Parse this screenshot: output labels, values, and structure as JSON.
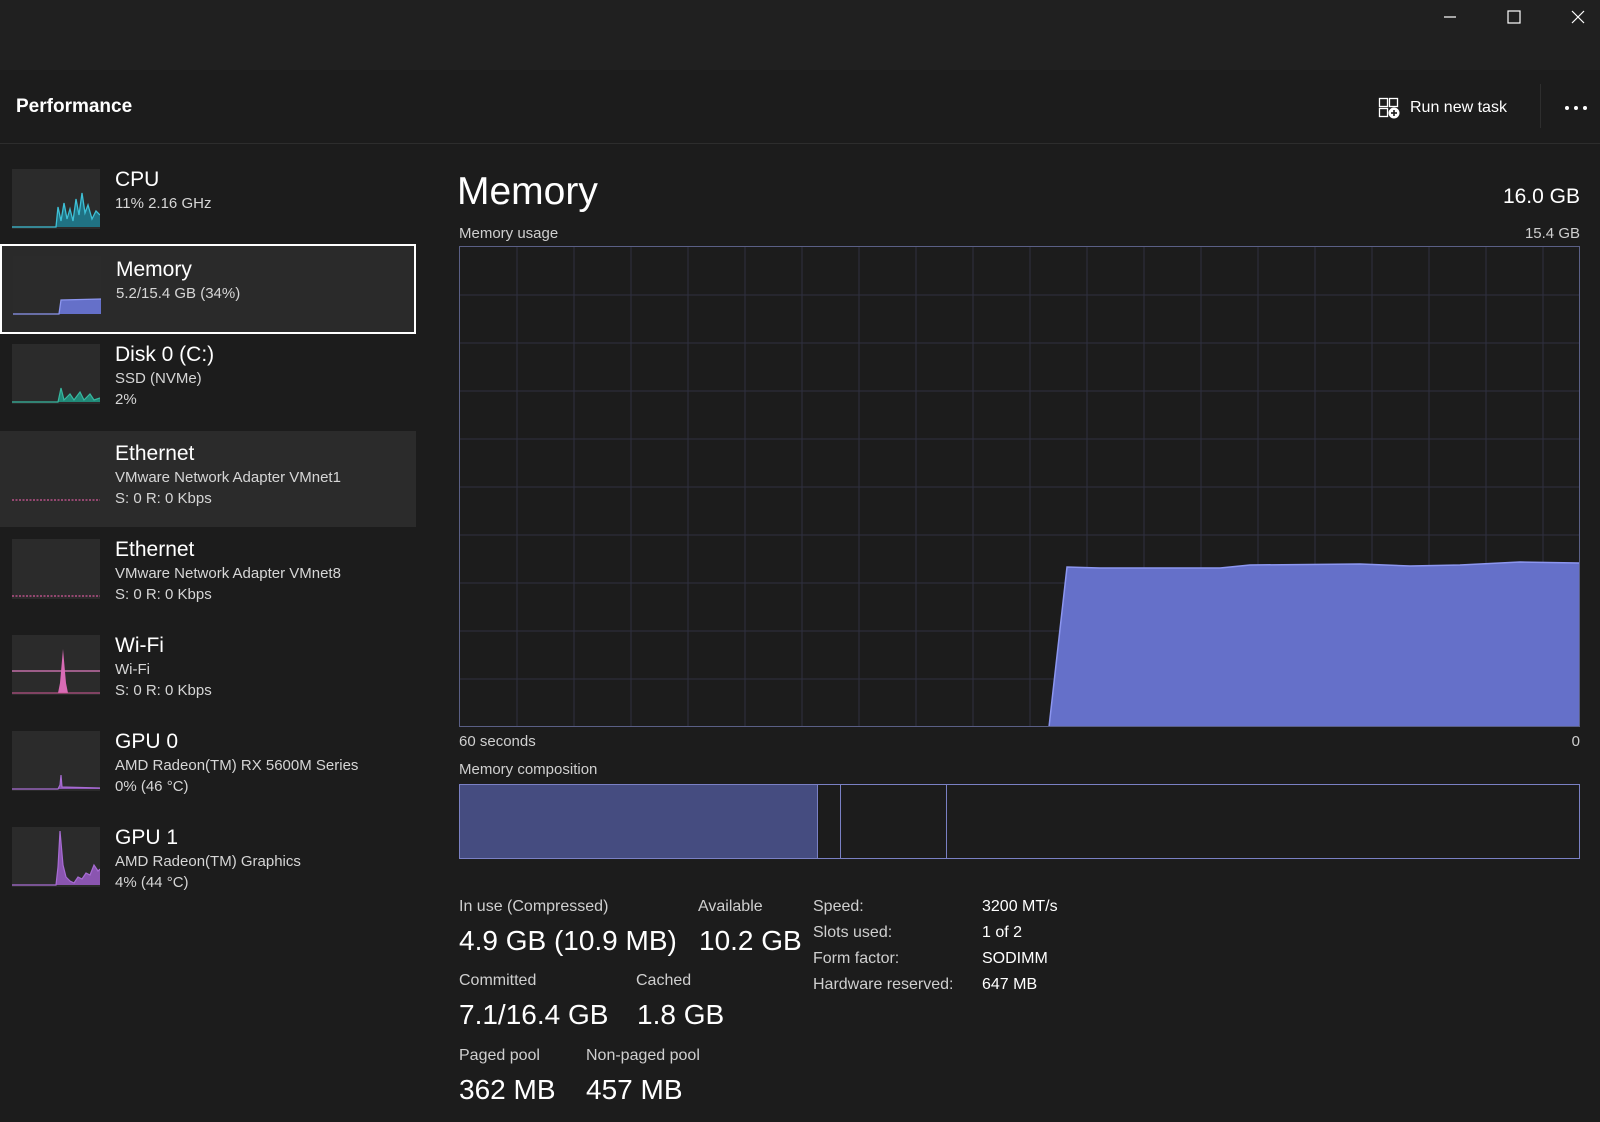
{
  "window": {
    "controls": {
      "minimize_icon": "minimize-icon",
      "maximize_icon": "maximize-icon",
      "close_icon": "close-icon"
    }
  },
  "header": {
    "title": "Performance",
    "run_new_task": "Run new task",
    "run_new_task_icon": "run-task-icon",
    "more_icon": "more-icon"
  },
  "sidebar": {
    "items": [
      {
        "title": "CPU",
        "line1": "11%  2.16 GHz",
        "line2": "",
        "color": "#3ec0d6"
      },
      {
        "title": "Memory",
        "line1": "5.2/15.4 GB (34%)",
        "line2": "",
        "color": "#7b87e8",
        "selected": true
      },
      {
        "title": "Disk 0 (C:)",
        "line1": "SSD (NVMe)",
        "line2": "2%",
        "color": "#37b8a0"
      },
      {
        "title": "Ethernet",
        "line1": "VMware Network Adapter VMnet1",
        "line2": "S: 0  R: 0 Kbps",
        "color": "#d4589a"
      },
      {
        "title": "Ethernet",
        "line1": "VMware Network Adapter VMnet8",
        "line2": "S: 0  R: 0 Kbps",
        "color": "#d4589a"
      },
      {
        "title": "Wi-Fi",
        "line1": "Wi-Fi",
        "line2": "S: 0  R: 0 Kbps",
        "color": "#e07bc0"
      },
      {
        "title": "GPU 0",
        "line1": "AMD Radeon(TM) RX 5600M Series",
        "line2": "0%  (46 °C)",
        "color": "#a86cd4"
      },
      {
        "title": "GPU 1",
        "line1": "AMD Radeon(TM) Graphics",
        "line2": "4%  (44 °C)",
        "color": "#a86cd4"
      }
    ]
  },
  "main": {
    "title": "Memory",
    "total": "16.0 GB",
    "usage_label": "Memory usage",
    "usage_max": "15.4 GB",
    "time_left": "60 seconds",
    "time_right": "0",
    "composition_label": "Memory composition",
    "colors": {
      "fill": "#6570c9",
      "line": "#8c96f0",
      "grid": "#2f3040",
      "composition": "#454c80"
    }
  },
  "stats": {
    "in_use_label": "In use (Compressed)",
    "in_use_value": "4.9 GB (10.9 MB)",
    "available_label": "Available",
    "available_value": "10.2 GB",
    "committed_label": "Committed",
    "committed_value": "7.1/16.4 GB",
    "cached_label": "Cached",
    "cached_value": "1.8 GB",
    "paged_label": "Paged pool",
    "paged_value": "362 MB",
    "nonpaged_label": "Non-paged pool",
    "nonpaged_value": "457 MB"
  },
  "details": {
    "speed_key": "Speed:",
    "speed_val": "3200 MT/s",
    "slots_key": "Slots used:",
    "slots_val": "1 of 2",
    "form_key": "Form factor:",
    "form_val": "SODIMM",
    "hwres_key": "Hardware reserved:",
    "hwres_val": "647 MB"
  }
}
